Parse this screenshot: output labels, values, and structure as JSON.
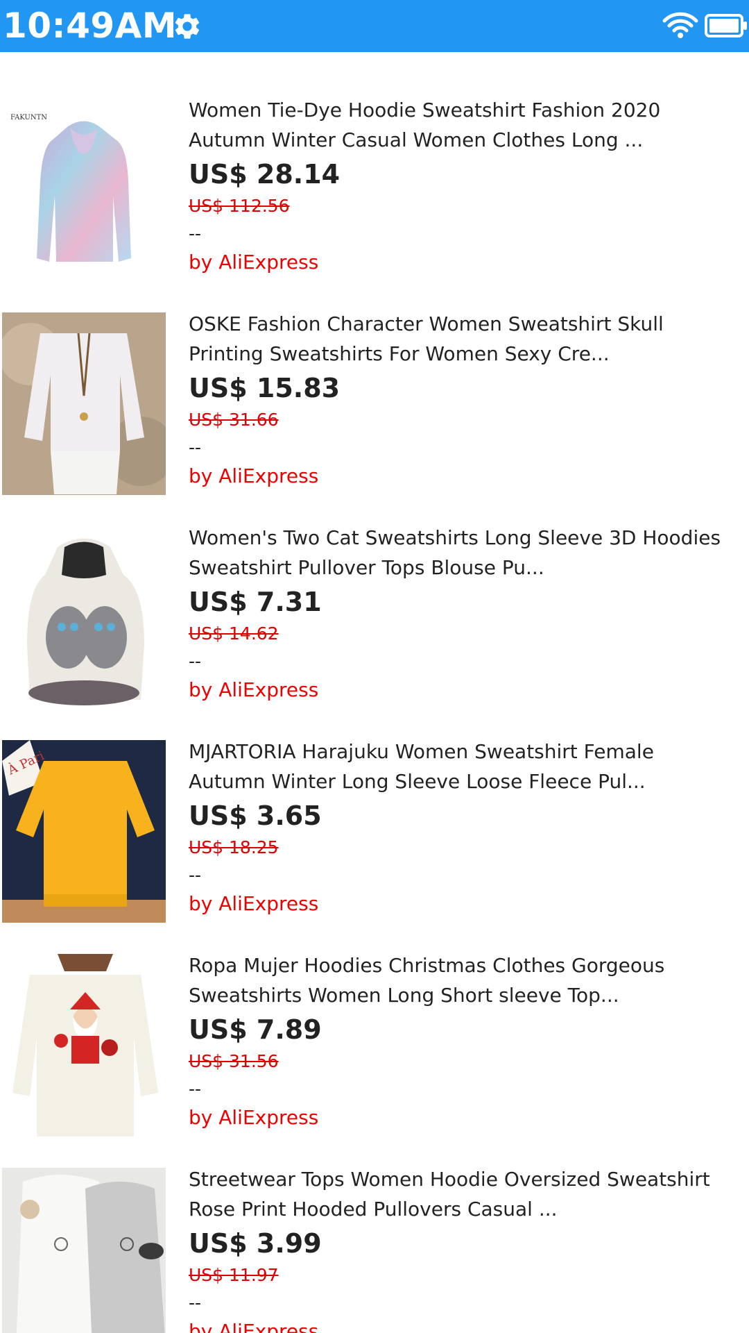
{
  "status_bar": {
    "time": "10:49AM",
    "icons": [
      "gear-icon",
      "wifi-icon",
      "battery-icon"
    ],
    "background_color": "#2196f3"
  },
  "products": [
    {
      "title": "Women Tie-Dye Hoodie Sweatshirt Fashion 2020\nAutumn Winter Casual Women Clothes Long ...",
      "price": "US$ 28.14",
      "original_price": "US$ 112.56",
      "rating": "--",
      "seller": "by AliExpress",
      "thumb_brand": "FAKUNTN"
    },
    {
      "title": "OSKE Fashion Character Women Sweatshirt Skull\nPrinting Sweatshirts For Women Sexy Cre...",
      "price": "US$ 15.83",
      "original_price": "US$ 31.66",
      "rating": "--",
      "seller": "by AliExpress"
    },
    {
      "title": "Women's Two Cat Sweatshirts Long Sleeve 3D Hoodies\nSweatshirt Pullover Tops Blouse Pu...",
      "price": "US$ 7.31",
      "original_price": "US$ 14.62",
      "rating": "--",
      "seller": "by AliExpress"
    },
    {
      "title": "MJARTORIA Harajuku Women Sweatshirt Female\nAutumn Winter Long Sleeve Loose Fleece Pul...",
      "price": "US$ 3.65",
      "original_price": "US$ 18.25",
      "rating": "--",
      "seller": "by AliExpress",
      "thumb_text": "À Pari"
    },
    {
      "title": "Ropa Mujer Hoodies Christmas Clothes Gorgeous\nSweatshirts Women Long Short sleeve Top...",
      "price": "US$ 7.89",
      "original_price": "US$ 31.56",
      "rating": "--",
      "seller": "by AliExpress"
    },
    {
      "title": "Streetwear Tops Women Hoodie Oversized Sweatshirt\nRose Print Hooded Pullovers Casual ...",
      "price": "US$ 3.99",
      "original_price": "US$ 11.97",
      "rating": "--",
      "seller": "by AliExpress"
    }
  ]
}
